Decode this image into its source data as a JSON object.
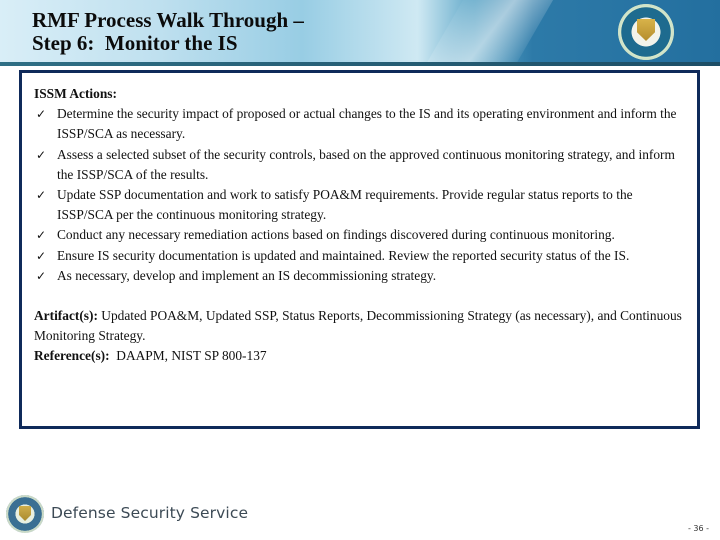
{
  "header": {
    "title_line1": "RMF Process Walk Through –",
    "title_line2": "Step 6:  Monitor the IS",
    "seal_icon": "dss-seal-icon"
  },
  "content": {
    "heading": "ISSM Actions:",
    "bullet_icon": "checkmark-icon",
    "actions": [
      "Determine the security impact of proposed or actual changes to the IS and its operating environment and inform the ISSP/SCA as necessary.",
      "Assess a selected subset of the security controls, based on the approved continuous monitoring strategy, and inform the ISSP/SCA of the results.",
      "Update SSP documentation and work to satisfy POA&M requirements. Provide regular status reports to the ISSP/SCA per the continuous monitoring strategy.",
      "Conduct any necessary remediation actions based on findings discovered during continuous monitoring.",
      "Ensure IS security documentation is updated and maintained. Review the reported security status of the IS.",
      "As necessary, develop and implement an IS decommissioning strategy."
    ],
    "artifacts_label": "Artifact(s):",
    "artifacts_text": " Updated POA&M, Updated SSP, Status Reports, Decommissioning Strategy (as necessary), and Continuous Monitoring Strategy.",
    "references_label": "Reference(s):",
    "references_text": "  DAAPM, NIST SP 800-137"
  },
  "footer": {
    "org_name": "Defense Security Service",
    "page_number": "- 36 -"
  },
  "colors": {
    "box_border": "#0f2a5a",
    "banner_dark": "#236f9f",
    "banner_light": "#d9eef7"
  }
}
